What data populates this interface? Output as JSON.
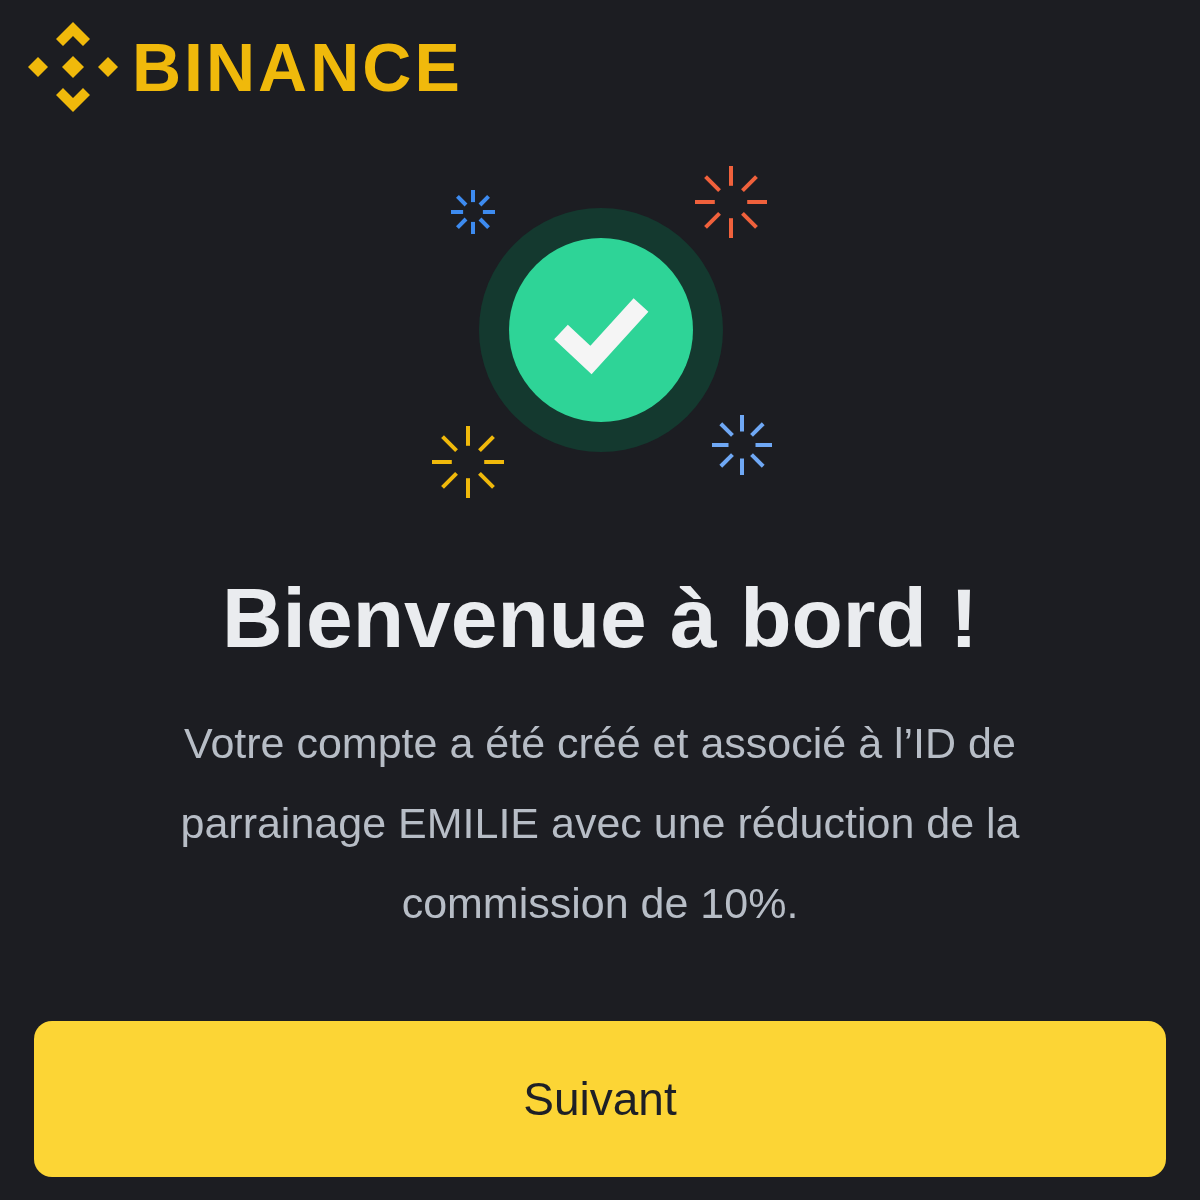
{
  "logo": {
    "text": "BINANCE"
  },
  "title": "Bienvenue à bord !",
  "message": "Votre compte a été créé et associé à l’ID de parrainage EMILIE avec une réduction de la commission de 10%.",
  "button": {
    "label": "Suivant"
  }
}
